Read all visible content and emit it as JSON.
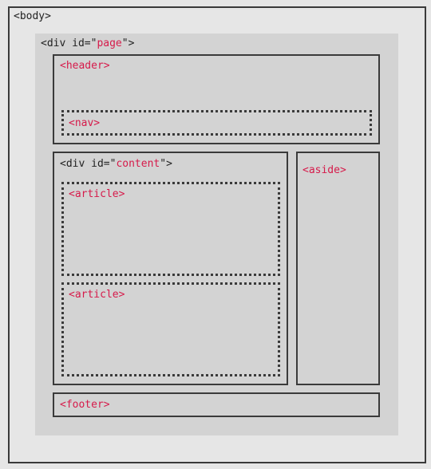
{
  "body_tag": "<body>",
  "page_tag": {
    "prefix": "<div id=\"",
    "value": "page",
    "suffix": "\">"
  },
  "header_tag": "<header>",
  "nav_tag": "<nav>",
  "content_tag": {
    "prefix": "<div id=\"",
    "value": "content",
    "suffix": "\">"
  },
  "article_tags": [
    "<article>",
    "<article>"
  ],
  "aside_tag": "<aside>",
  "footer_tag": "<footer>",
  "colors": {
    "tag_text": "#222222",
    "element_text": "#d61a4a",
    "outer_background": "#e6e6e6",
    "box_fill": "#d3d3d3",
    "border": "#3a3a3a"
  }
}
